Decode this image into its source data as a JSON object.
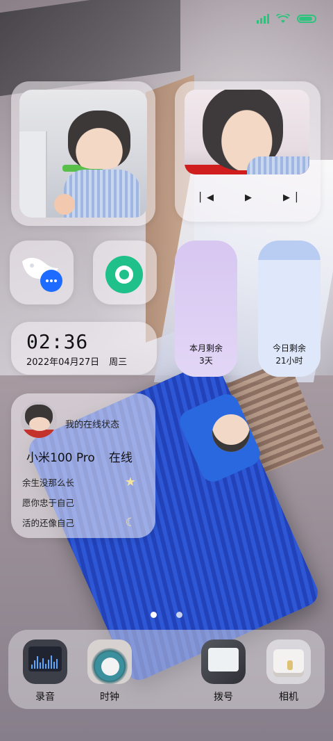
{
  "status_bar": {
    "signal_icon": "signal-icon",
    "wifi_icon": "wifi-icon",
    "battery_icon": "battery-icon",
    "accent_color": "#2ec27e"
  },
  "widgets": {
    "clock": {
      "time": "02:36",
      "date": "2022年04月27日",
      "weekday": "周三"
    },
    "countdown": {
      "month_label": "本月剩余",
      "month_value": "3天",
      "day_label": "今日剩余",
      "day_value": "21小时"
    },
    "status": {
      "title": "我的在线状态",
      "device": "小米100 Pro",
      "state": "在线",
      "lines": [
        {
          "text": "余生没那么长",
          "icon": "star-icon"
        },
        {
          "text": "愿你忠于自己",
          "icon": ""
        },
        {
          "text": "活的还像自己",
          "icon": "moon-icon"
        }
      ]
    },
    "music": {
      "prev_icon": "skip-previous-icon",
      "play_icon": "play-icon",
      "next_icon": "skip-next-icon"
    }
  },
  "page_indicator": {
    "current": 1,
    "total": 2
  },
  "dock": {
    "apps": [
      {
        "label": "录音",
        "icon": "recorder-icon"
      },
      {
        "label": "时钟",
        "icon": "alarm-clock-icon"
      },
      {
        "label": "拨号",
        "icon": "dialer-icon"
      },
      {
        "label": "相机",
        "icon": "camera-icon"
      }
    ]
  },
  "colors": {
    "month_fill": "#d7c7f1",
    "day_fill": "#dfe8fa",
    "green_app": "#1fc08a",
    "feishu_blue": "#1e6bff"
  }
}
